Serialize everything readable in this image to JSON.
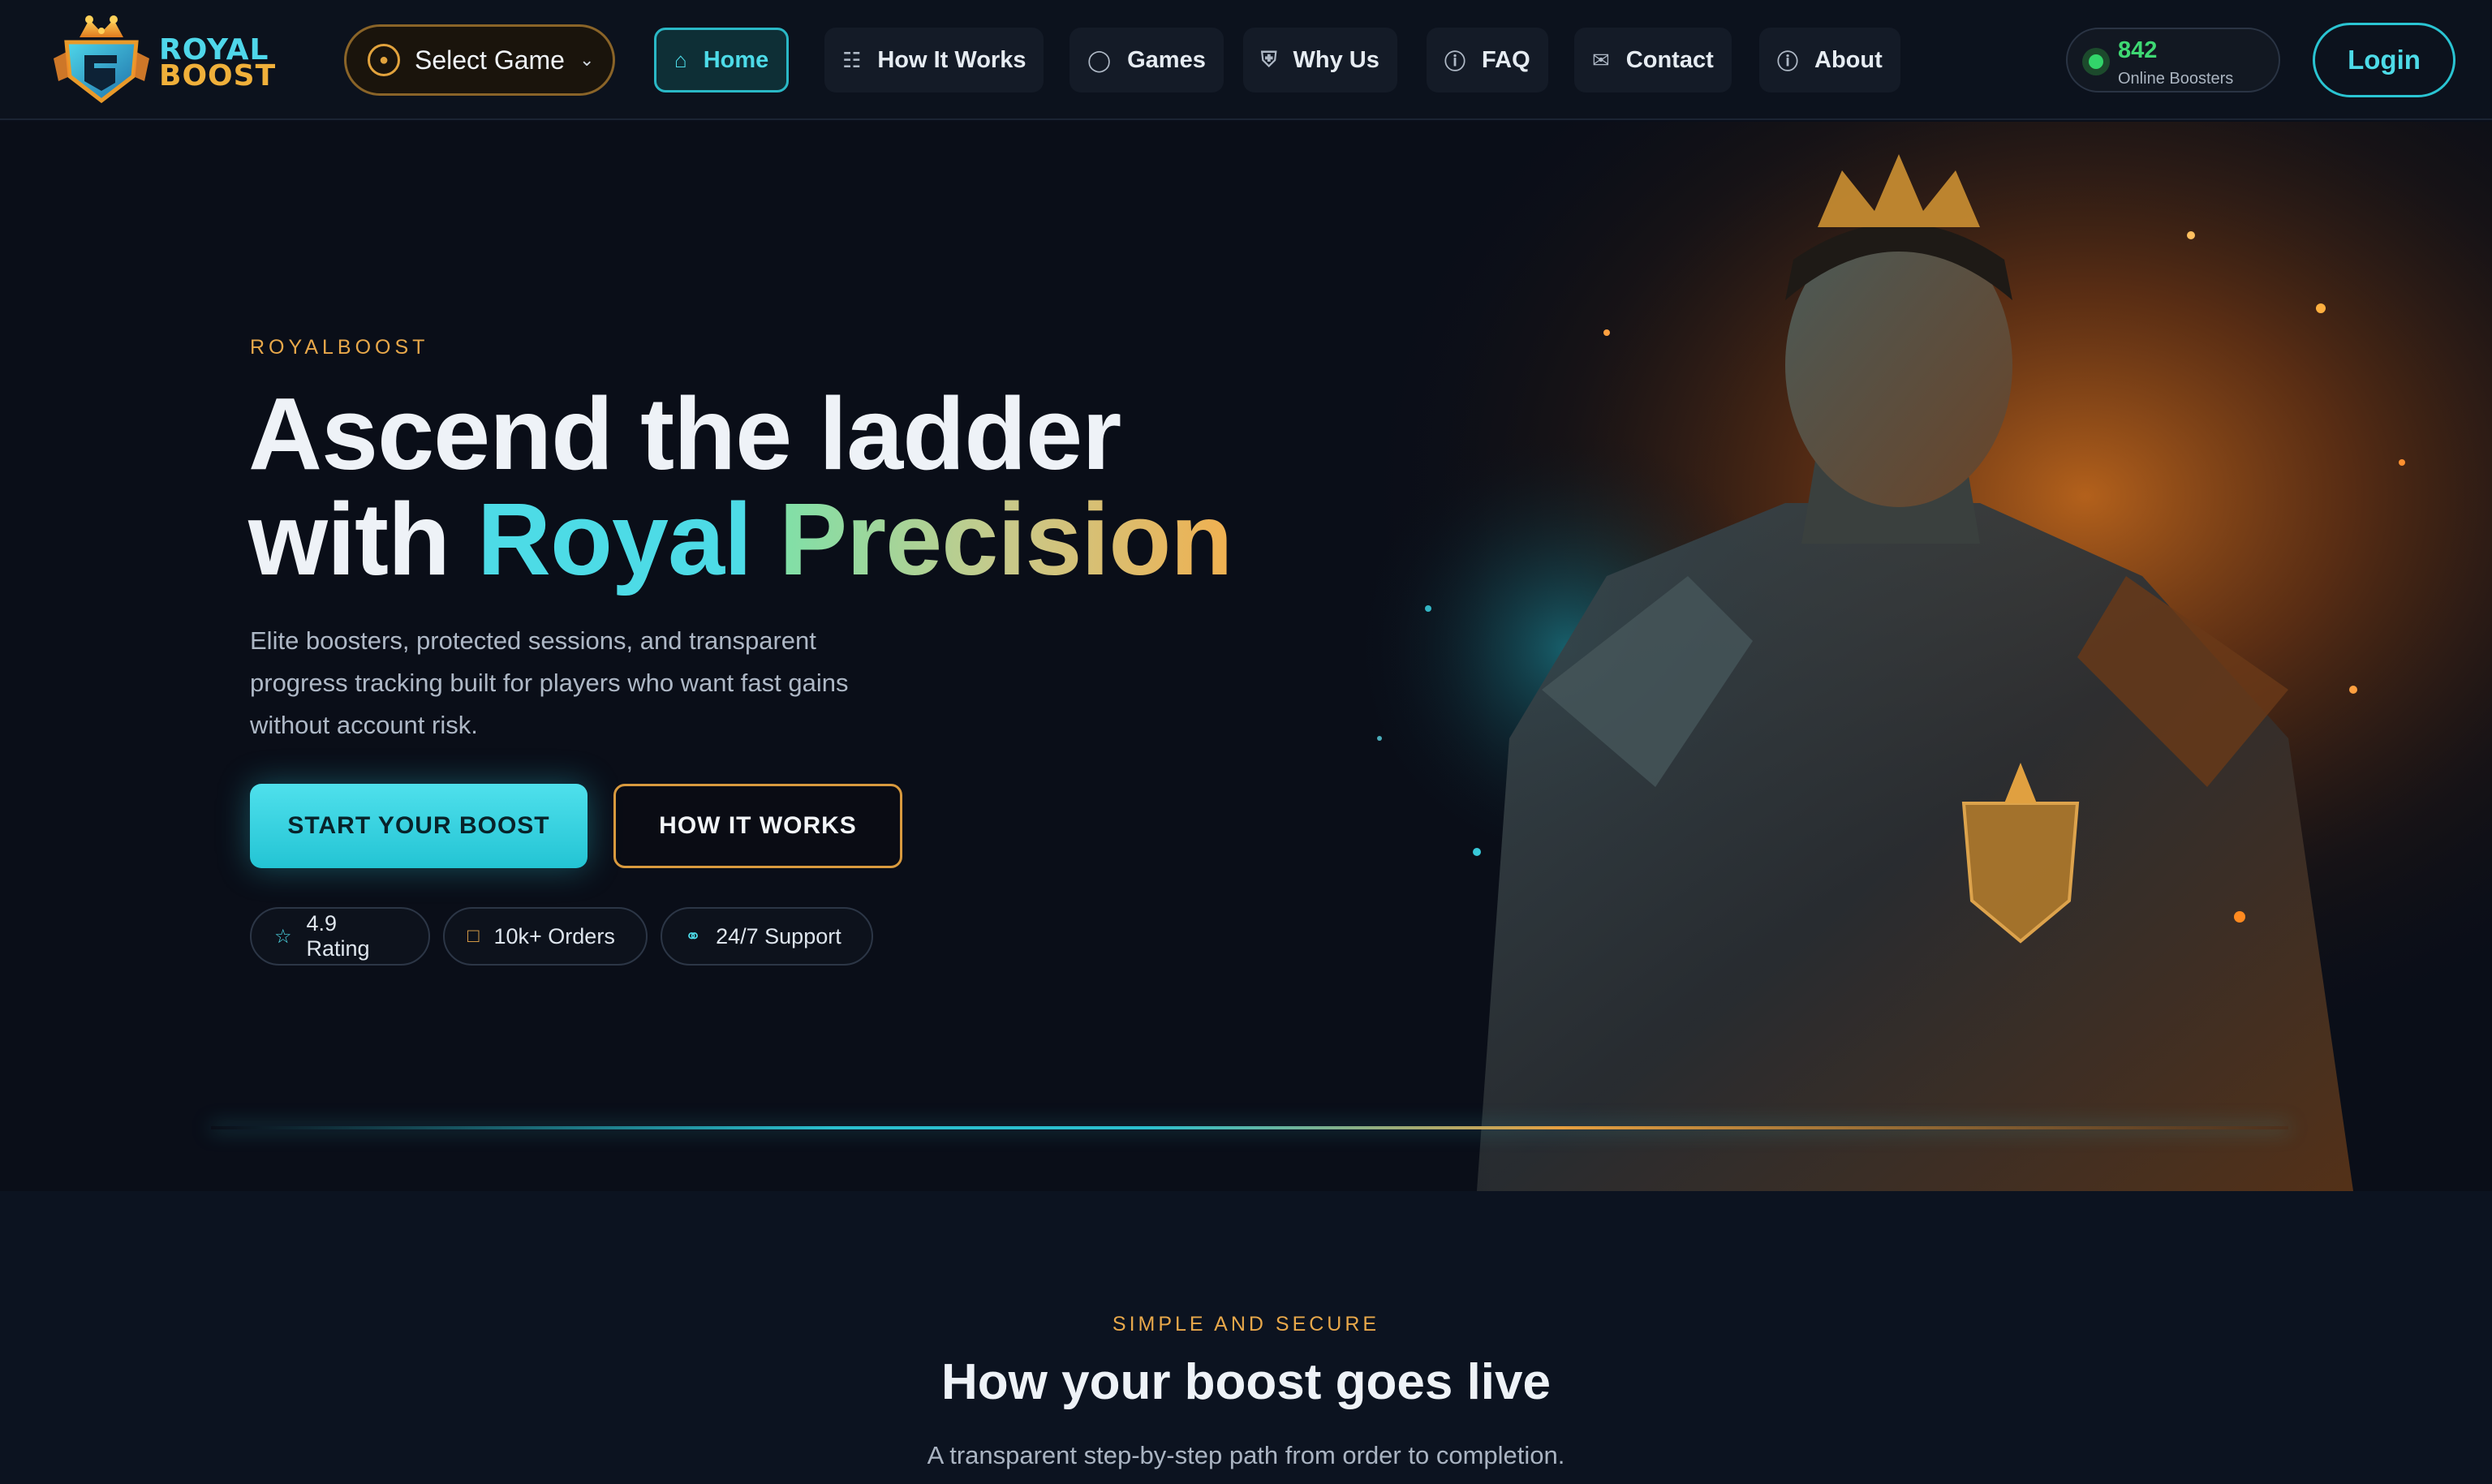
{
  "brand": {
    "line1": "ROYAL",
    "line2": "BOOST"
  },
  "nav": {
    "select_game": "Select Game",
    "items": [
      {
        "label": "Home",
        "icon": "home-icon",
        "active": true
      },
      {
        "label": "How It Works",
        "icon": "network-icon",
        "active": false
      },
      {
        "label": "Games",
        "icon": "gamepad-icon",
        "active": false
      },
      {
        "label": "Why Us",
        "icon": "shield-icon",
        "active": false
      },
      {
        "label": "FAQ",
        "icon": "help-circle-icon",
        "active": false
      },
      {
        "label": "Contact",
        "icon": "mail-icon",
        "active": false
      },
      {
        "label": "About",
        "icon": "info-icon",
        "active": false
      }
    ],
    "online_count": "842",
    "online_label": "Online Boosters",
    "login": "Login"
  },
  "hero": {
    "eyebrow": "ROYALBOOST",
    "headline_line1": "Ascend the ladder",
    "headline_with": "with",
    "headline_royal": "Royal",
    "headline_precision": "Precision",
    "subtitle": "Elite boosters, protected sessions, and transparent progress tracking built for players who want fast gains without account risk.",
    "cta_primary": "START YOUR BOOST",
    "cta_secondary": "HOW IT WORKS",
    "chips": [
      {
        "label": "4.9 Rating",
        "icon": "star-icon"
      },
      {
        "label": "10k+ Orders",
        "icon": "bag-icon"
      },
      {
        "label": "24/7 Support",
        "icon": "headset-icon"
      }
    ]
  },
  "section": {
    "eyebrow": "SIMPLE AND SECURE",
    "title": "How your boost goes live",
    "subtitle": "A transparent step-by-step path from order to completion."
  },
  "colors": {
    "accent_cyan": "#2ac4d2",
    "accent_gold": "#e8a84a",
    "online_green": "#32d46a",
    "background": "#0a0f1a"
  }
}
